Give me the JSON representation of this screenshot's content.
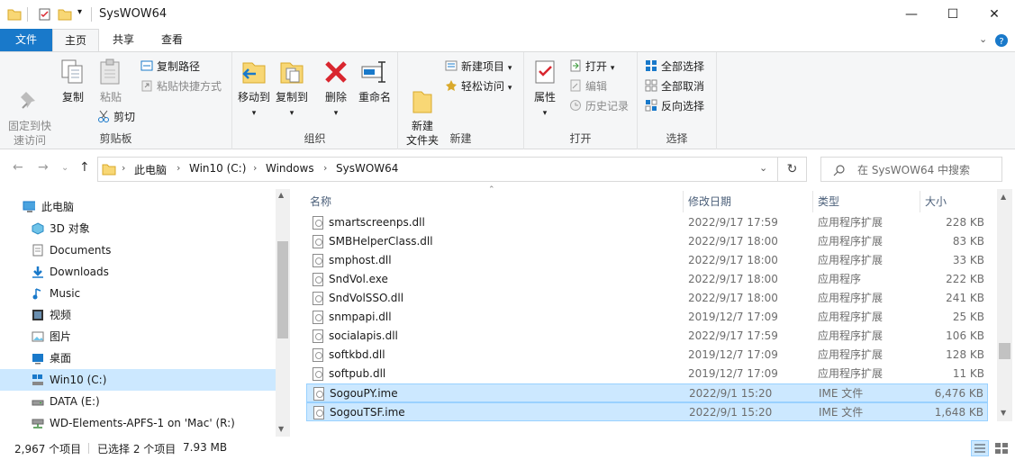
{
  "window": {
    "title": "SysWOW64",
    "minimize": "—",
    "maximize": "☐",
    "close": "✕"
  },
  "tabs": {
    "file": "文件",
    "home": "主页",
    "share": "共享",
    "view": "查看"
  },
  "ribbon": {
    "clipboard": {
      "pin": "固定到快\n速访问",
      "copy": "复制",
      "paste": "粘贴",
      "copy_path": "复制路径",
      "paste_shortcut": "粘贴快捷方式",
      "cut": "剪切",
      "label": "剪贴板"
    },
    "organize": {
      "move_to": "移动到",
      "copy_to": "复制到",
      "delete": "删除",
      "rename": "重命名",
      "label": "组织"
    },
    "new": {
      "new_folder": "新建\n文件夹",
      "new_item": "新建项目",
      "easy_access": "轻松访问",
      "label": "新建"
    },
    "open": {
      "properties": "属性",
      "open": "打开",
      "edit": "编辑",
      "history": "历史记录",
      "label": "打开"
    },
    "select": {
      "select_all": "全部选择",
      "select_none": "全部取消",
      "invert": "反向选择",
      "label": "选择"
    }
  },
  "address": {
    "crumbs": [
      "此电脑",
      "Win10 (C:)",
      "Windows",
      "SysWOW64"
    ],
    "search_placeholder": "在 SysWOW64 中搜索"
  },
  "nav": [
    {
      "label": "此电脑",
      "icon": "computer-icon",
      "indent": 1
    },
    {
      "label": "3D 对象",
      "icon": "3d-objects-icon",
      "indent": 2
    },
    {
      "label": "Documents",
      "icon": "documents-icon",
      "indent": 2
    },
    {
      "label": "Downloads",
      "icon": "downloads-icon",
      "indent": 2
    },
    {
      "label": "Music",
      "icon": "music-icon",
      "indent": 2
    },
    {
      "label": "视频",
      "icon": "video-icon",
      "indent": 2
    },
    {
      "label": "图片",
      "icon": "pictures-icon",
      "indent": 2
    },
    {
      "label": "桌面",
      "icon": "desktop-icon",
      "indent": 2
    },
    {
      "label": "Win10 (C:)",
      "icon": "system-drive-icon",
      "indent": 2,
      "selected": true
    },
    {
      "label": "DATA (E:)",
      "icon": "drive-icon",
      "indent": 2
    },
    {
      "label": "WD-Elements-APFS-1 on 'Mac' (R:)",
      "icon": "network-drive-icon",
      "indent": 2
    }
  ],
  "columns": {
    "name": "名称",
    "date": "修改日期",
    "type": "类型",
    "size": "大小"
  },
  "files": [
    {
      "name": "smartscreenps.dll",
      "date": "2022/9/17 17:59",
      "type": "应用程序扩展",
      "size": "228 KB"
    },
    {
      "name": "SMBHelperClass.dll",
      "date": "2022/9/17 18:00",
      "type": "应用程序扩展",
      "size": "83 KB"
    },
    {
      "name": "smphost.dll",
      "date": "2022/9/17 18:00",
      "type": "应用程序扩展",
      "size": "33 KB"
    },
    {
      "name": "SndVol.exe",
      "date": "2022/9/17 18:00",
      "type": "应用程序",
      "size": "222 KB"
    },
    {
      "name": "SndVolSSO.dll",
      "date": "2022/9/17 18:00",
      "type": "应用程序扩展",
      "size": "241 KB"
    },
    {
      "name": "snmpapi.dll",
      "date": "2019/12/7 17:09",
      "type": "应用程序扩展",
      "size": "25 KB"
    },
    {
      "name": "socialapis.dll",
      "date": "2022/9/17 17:59",
      "type": "应用程序扩展",
      "size": "106 KB"
    },
    {
      "name": "softkbd.dll",
      "date": "2019/12/7 17:09",
      "type": "应用程序扩展",
      "size": "128 KB"
    },
    {
      "name": "softpub.dll",
      "date": "2019/12/7 17:09",
      "type": "应用程序扩展",
      "size": "11 KB"
    },
    {
      "name": "SogouPY.ime",
      "date": "2022/9/1 15:20",
      "type": "IME 文件",
      "size": "6,476 KB",
      "selected": true
    },
    {
      "name": "SogouTSF.ime",
      "date": "2022/9/1 15:20",
      "type": "IME 文件",
      "size": "1,648 KB",
      "selected": true
    }
  ],
  "status": {
    "item_count": "2,967 个项目",
    "selected": "已选择 2 个项目",
    "selected_size": "7.93 MB"
  },
  "colors": {
    "accent": "#1979ca",
    "selection": "#cce8ff",
    "folder": "#f8d775",
    "delete": "#d9262f"
  }
}
